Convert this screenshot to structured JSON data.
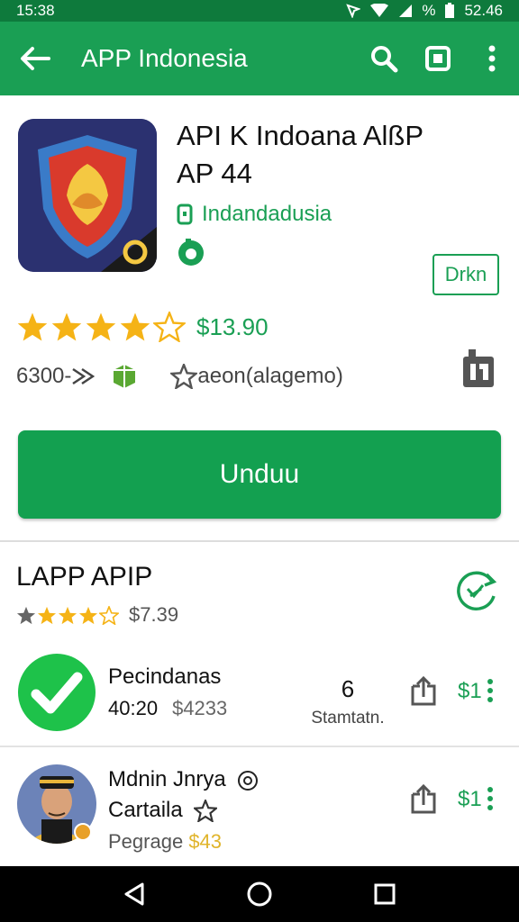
{
  "status_bar": {
    "time": "15:38",
    "battery_pct": "%",
    "clock_right": "52.46"
  },
  "app_bar": {
    "title": "APP Indonesia",
    "back_icon": "arrow-left-icon",
    "search_icon": "search-icon",
    "square_icon": "square-icon",
    "menu_icon": "more-vert-icon"
  },
  "app": {
    "title_line1": "API K Indoana AlßP",
    "title_line2": "AP 44",
    "developer": "Indandadusia",
    "details_label": "Drkn",
    "rating_stars": 4.5,
    "rating_value": "$13.90",
    "meta_size": "6300-",
    "meta_text": "aeon(alagemo)",
    "install_label": "Unduu",
    "brand_color": "#1a9f54"
  },
  "section": {
    "title": "LAPP APIP",
    "rating_stars": 4,
    "price": "$7.39"
  },
  "list": [
    {
      "name": "Pecindanas",
      "time": "40:20",
      "price_muted": "$4233",
      "count": "6",
      "count_label": "Stamtatn.",
      "price": "$1",
      "icon": "check-circle-icon"
    },
    {
      "name_line1": "Mdnin Jnrya",
      "name_line2": "Cartaila",
      "sub": "Pegrage",
      "sub_highlight": "$43",
      "price": "$1",
      "icon": "avatar-icon"
    }
  ]
}
